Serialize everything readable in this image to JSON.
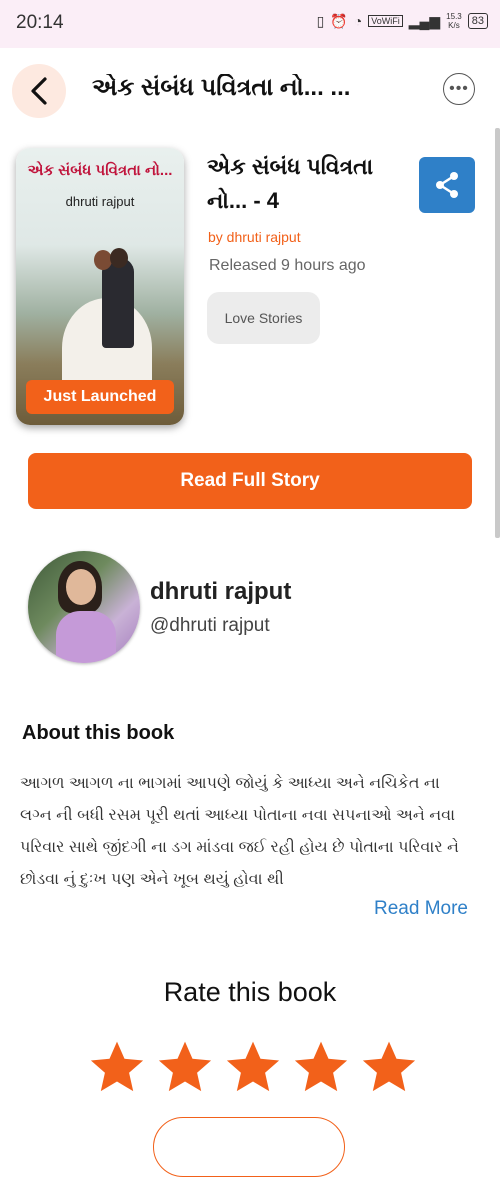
{
  "status_bar": {
    "time": "20:14",
    "net_speed": "15.3\nK/s",
    "network_label": "VoWiFi",
    "battery": "83"
  },
  "header": {
    "title": "એક સંબંધ પવિત્રતા નો... ..."
  },
  "book": {
    "cover_title": "એક સંબંધ પવિત્રતા નો...",
    "cover_author": "dhruti rajput",
    "badge": "Just Launched",
    "title": "એક સંબંધ પવિત્રતા નો... - 4",
    "by_author": "by dhruti rajput",
    "released": "Released 9 hours ago",
    "genre": "Love Stories",
    "read_button": "Read Full Story"
  },
  "author": {
    "name": "dhruti rajput",
    "handle": "@dhruti rajput"
  },
  "about": {
    "heading": "About this book",
    "text": "આગળ આગળ ના ભાગમાં આપણે જોયું કે આધ્યા અને નચિકેત ના લગ્ન ની બધી રસમ પૂરી થતાં આધ્યા પોતાના નવા સપનાઓ અને નવા પરિવાર સાથે જીંદગી ના ડગ માંડવા જઈ રહી હોય છે પોતાના પરિવાર ને છોડવા નું દુઃખ પણ એને ખૂબ થયું હોવા થી",
    "read_more": "Read More"
  },
  "rating": {
    "heading": "Rate this book",
    "stars": 5,
    "star_color": "#f2611a"
  },
  "colors": {
    "accent": "#f2611a",
    "link": "#2f80c8"
  }
}
